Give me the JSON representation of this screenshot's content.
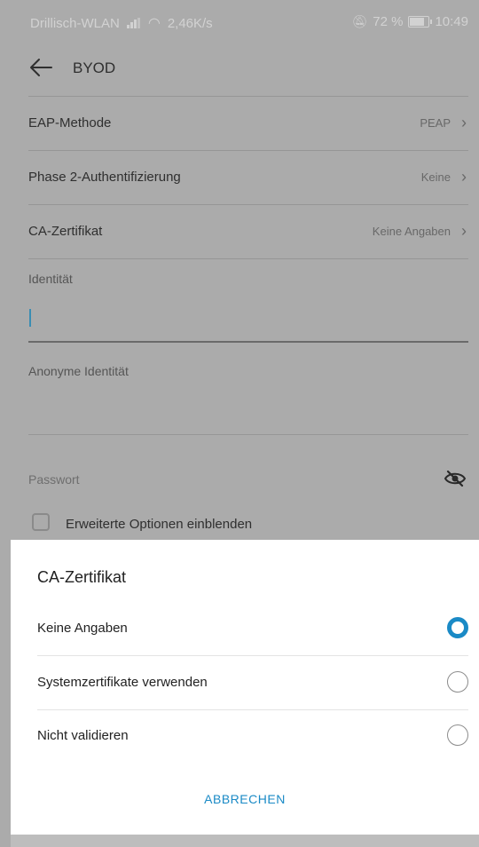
{
  "status_bar": {
    "carrier": "Drillisch-WLAN",
    "speed": "2,46K/s",
    "battery": "72 %",
    "time": "10:49"
  },
  "toolbar": {
    "title": "BYOD"
  },
  "settings": [
    {
      "label": "EAP-Methode",
      "value": "PEAP"
    },
    {
      "label": "Phase 2-Authentifizierung",
      "value": "Keine"
    },
    {
      "label": "CA-Zertifikat",
      "value": "Keine Angaben"
    }
  ],
  "identity": {
    "label": "Identität",
    "value": ""
  },
  "anon_identity": {
    "label": "Anonyme Identität",
    "value": ""
  },
  "password": {
    "label": "Passwort"
  },
  "advanced": {
    "label": "Erweiterte Optionen einblenden",
    "checked": false
  },
  "dialog": {
    "title": "CA-Zertifikat",
    "options": [
      {
        "label": "Keine Angaben",
        "selected": true
      },
      {
        "label": "Systemzertifikate verwenden",
        "selected": false
      },
      {
        "label": "Nicht validieren",
        "selected": false
      }
    ],
    "cancel": "ABBRECHEN"
  },
  "colors": {
    "accent": "#1a8ac6",
    "scrim": "#ababab"
  },
  "icons": [
    "back-arrow-icon",
    "chevron-right-icon",
    "visibility-off-icon",
    "wifi-icon",
    "signal-icon",
    "battery-icon",
    "mute-icon"
  ]
}
